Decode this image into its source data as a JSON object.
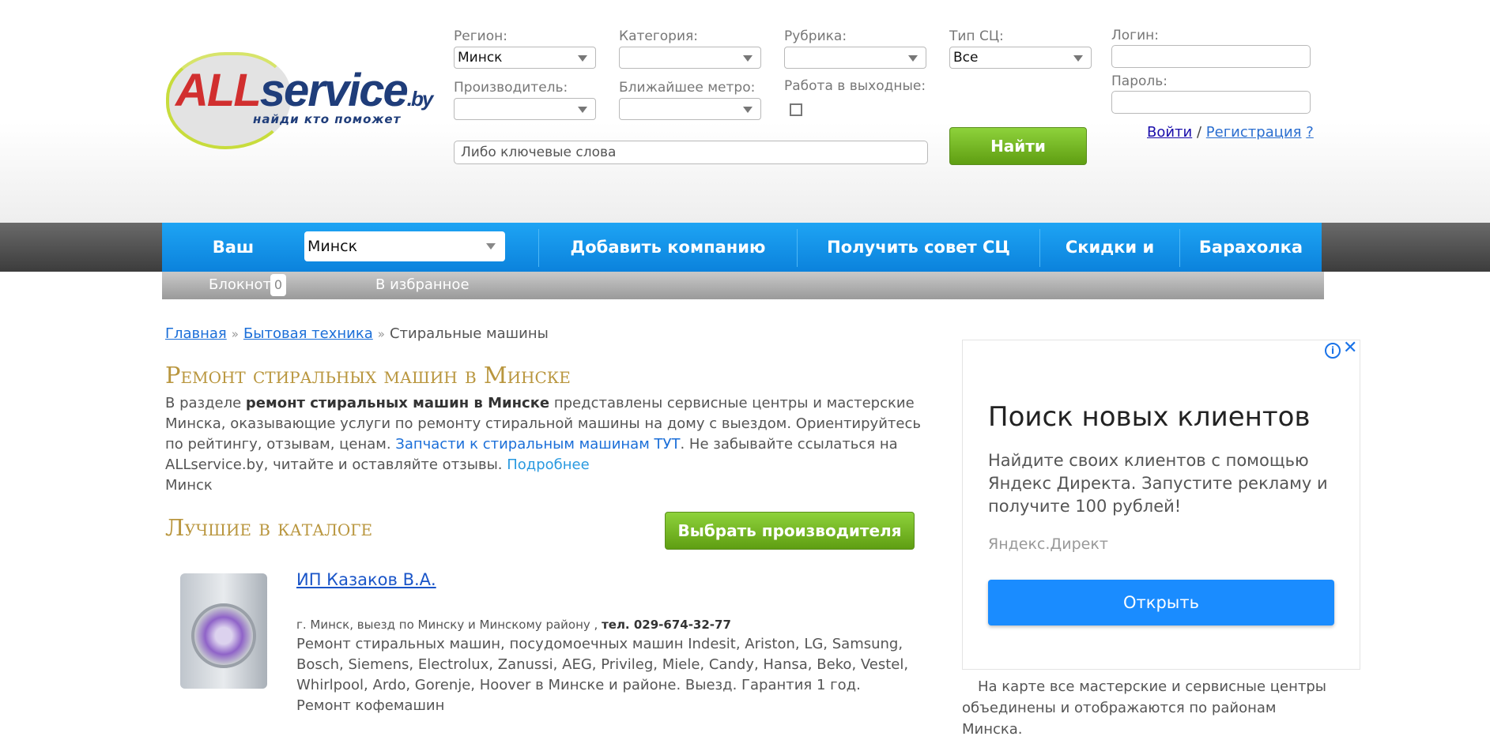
{
  "search": {
    "region_label": "Регион:",
    "region_value": "Минск",
    "category_label": "Категория:",
    "category_value": "",
    "rubric_label": "Рубрика:",
    "rubric_value": "",
    "type_label": "Тип СЦ:",
    "type_value": "Все",
    "manufacturer_label": "Производитель:",
    "manufacturer_value": "",
    "metro_label": "Ближайшее метро:",
    "metro_value": "",
    "weekend_label": "Работа в выходные:",
    "weekend_checked": false,
    "keywords_placeholder": "Либо ключевые слова",
    "find_button": "Найти"
  },
  "auth": {
    "login_label": "Логин:",
    "password_label": "Пароль:",
    "login_link": "Войти",
    "separator": "/",
    "register_link": "Регистрация",
    "help_link": "?"
  },
  "nav": {
    "region_label": "Ваш регион",
    "region_value": "Минск",
    "items": [
      "Добавить компанию",
      "Получить совет СЦ",
      "Скидки и акции",
      "Барахолка"
    ]
  },
  "subnav": {
    "notebook_label": "Блокнот",
    "notebook_count": "0",
    "favorites_label": "В избранное"
  },
  "breadcrumbs": [
    "Главная",
    "Бытовая техника",
    "Стиральные машины"
  ],
  "page": {
    "title": "Ремонт стиральных машин в Минске",
    "intro_1": "В разделе ",
    "intro_bold": "ремонт стиральных машин в Минске",
    "intro_2": " представлены сервисные центры и мастерские Минска, оказывающие услуги по ремонту стиральной машины на дому с выездом. Ориентируйтесь по рейтингу, отзывам, ценам. ",
    "intro_parts_link": "Запчасти к стиральным машинам ТУТ",
    "intro_3": ". Не забывайте ссылаться на ALLservice.by, читайте и оставляйте отзывы. ",
    "intro_more": "Подробнее",
    "city": "Минск",
    "best_title": "Лучшие в каталоге",
    "choose_manufacturer": "Выбрать производителя"
  },
  "companies": [
    {
      "name": "ИП Казаков В.А.",
      "address": "г. Минск, выезд по Минску и Минскому району , ",
      "phone": "тел. 029-674-32-77",
      "description": "Ремонт стиральных машин, посудомоечных машин Indesit, Ariston, LG, Samsung, Bosch, Siemens, Electrolux, Zanussi, AEG, Privileg, Miele, Candy, Hansa, Beko, Vestel, Whirlpool, Ardo, Gorenje, Hoover в Минске и районе. Выезд. Гарантия 1 год. Ремонт кофемашин"
    }
  ],
  "ad": {
    "title": "Поиск новых клиентов",
    "text": "Найдите своих клиентов с помощью Яндекс Директа. Запустите рекламу и получите 100 рублей!",
    "source": "Яндекс.Директ",
    "button": "Открыть"
  },
  "map_note": "На карте все мастерские и сервисные центры объединены и отображаются по районам Минска."
}
